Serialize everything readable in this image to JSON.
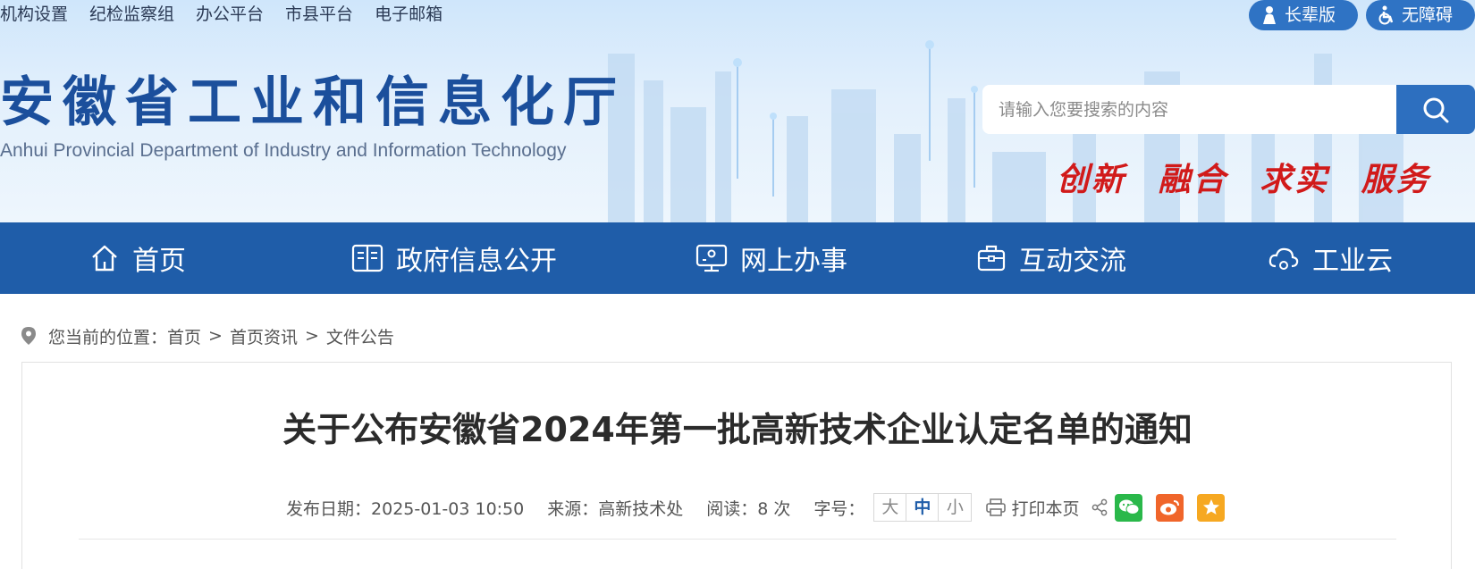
{
  "top_links": [
    "机构设置",
    "纪检监察组",
    "办公平台",
    "市县平台",
    "电子邮箱"
  ],
  "pills": {
    "elder": "长辈版",
    "accessible": "无障碍"
  },
  "site": {
    "title": "安徽省工业和信息化厅",
    "subtitle": "Anhui Provincial Department of Industry and Information Technology",
    "slogan": "创新 融合 求实 服务"
  },
  "search": {
    "placeholder": "请输入您要搜索的内容"
  },
  "nav": {
    "home": "首页",
    "gov_info": "政府信息公开",
    "online": "网上办事",
    "interact": "互动交流",
    "cloud": "工业云"
  },
  "breadcrumb": {
    "prefix": "您当前的位置：",
    "items": [
      "首页",
      "首页资讯",
      "文件公告"
    ],
    "separator": ">"
  },
  "article": {
    "title": "关于公布安徽省2024年第一批高新技术企业认定名单的通知",
    "date_label": "发布日期：",
    "date": "2025-01-03 10:50",
    "source_label": "来源：",
    "source": "高新技术处",
    "views_label": "阅读：",
    "views": "8 次",
    "fontsize_label": "字号：",
    "font_sizes": [
      "大",
      "中",
      "小"
    ],
    "print_label": "打印本页"
  },
  "colors": {
    "nav_bg": "#1f5da9",
    "title_blue": "#1b4f9c",
    "slogan_red": "#d11a1a",
    "wechat": "#2ab84a",
    "weibo": "#f0652a",
    "favorite": "#f6a821"
  }
}
